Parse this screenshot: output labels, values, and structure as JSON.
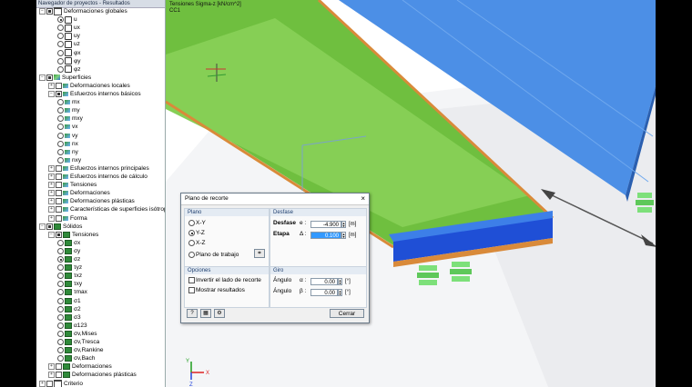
{
  "navigator": {
    "title": "Navegador de proyectos - Resultados",
    "rows": [
      {
        "label": "Deformaciones globales",
        "indent": 0,
        "toggle": "−",
        "kind": "cb",
        "checked": true,
        "icon": "ico-def"
      },
      {
        "label": "u",
        "indent": 2,
        "kind": "rd",
        "checked": true,
        "icon": "ico-mode"
      },
      {
        "label": "ux",
        "indent": 2,
        "kind": "rd",
        "icon": "ico-mode"
      },
      {
        "label": "uy",
        "indent": 2,
        "kind": "rd",
        "icon": "ico-mode"
      },
      {
        "label": "uz",
        "indent": 2,
        "kind": "rd",
        "icon": "ico-mode"
      },
      {
        "label": "φx",
        "indent": 2,
        "kind": "rd",
        "icon": "ico-mode"
      },
      {
        "label": "φy",
        "indent": 2,
        "kind": "rd",
        "icon": "ico-mode"
      },
      {
        "label": "φz",
        "indent": 2,
        "kind": "rd",
        "icon": "ico-mode"
      },
      {
        "label": "Superficies",
        "indent": 0,
        "toggle": "−",
        "kind": "cb",
        "checked": true,
        "icon": "ico-surf"
      },
      {
        "label": "Deformaciones locales",
        "indent": 1,
        "toggle": "+",
        "kind": "cb",
        "icon": "ico-sub"
      },
      {
        "label": "Esfuerzos internos básicos",
        "indent": 1,
        "toggle": "−",
        "kind": "cb",
        "checked": true,
        "icon": "ico-sub"
      },
      {
        "label": "mx",
        "indent": 2,
        "kind": "rd",
        "icon": "ico-sub"
      },
      {
        "label": "my",
        "indent": 2,
        "kind": "rd",
        "icon": "ico-sub"
      },
      {
        "label": "mxy",
        "indent": 2,
        "kind": "rd",
        "icon": "ico-sub"
      },
      {
        "label": "vx",
        "indent": 2,
        "kind": "rd",
        "icon": "ico-sub"
      },
      {
        "label": "vy",
        "indent": 2,
        "kind": "rd",
        "icon": "ico-sub"
      },
      {
        "label": "nx",
        "indent": 2,
        "kind": "rd",
        "icon": "ico-sub"
      },
      {
        "label": "ny",
        "indent": 2,
        "kind": "rd",
        "icon": "ico-sub"
      },
      {
        "label": "nxy",
        "indent": 2,
        "kind": "rd",
        "icon": "ico-sub"
      },
      {
        "label": "Esfuerzos internos principales",
        "indent": 1,
        "toggle": "+",
        "kind": "cb",
        "icon": "ico-sub"
      },
      {
        "label": "Esfuerzos internos de cálculo",
        "indent": 1,
        "toggle": "+",
        "kind": "cb",
        "icon": "ico-sub"
      },
      {
        "label": "Tensiones",
        "indent": 1,
        "toggle": "+",
        "kind": "cb",
        "icon": "ico-sub"
      },
      {
        "label": "Deformaciones",
        "indent": 1,
        "toggle": "+",
        "kind": "cb",
        "icon": "ico-sub"
      },
      {
        "label": "Deformaciones plásticas",
        "indent": 1,
        "toggle": "+",
        "kind": "cb",
        "icon": "ico-sub"
      },
      {
        "label": "Características de superficies isótropas",
        "indent": 1,
        "toggle": "+",
        "kind": "cb",
        "icon": "ico-sub"
      },
      {
        "label": "Forma",
        "indent": 1,
        "toggle": "+",
        "kind": "cb",
        "icon": "ico-sub"
      },
      {
        "label": "Sólidos",
        "indent": 0,
        "toggle": "−",
        "kind": "cb",
        "checked": true,
        "icon": "ico-sol"
      },
      {
        "label": "Tensiones",
        "indent": 1,
        "toggle": "−",
        "kind": "cb",
        "checked": true,
        "icon": "ico-sol"
      },
      {
        "label": "σx",
        "indent": 2,
        "kind": "rd",
        "icon": "ico-sol"
      },
      {
        "label": "σy",
        "indent": 2,
        "kind": "rd",
        "icon": "ico-sol"
      },
      {
        "label": "σz",
        "indent": 2,
        "kind": "rd",
        "checked": true,
        "icon": "ico-sol"
      },
      {
        "label": "τyz",
        "indent": 2,
        "kind": "rd",
        "icon": "ico-sol"
      },
      {
        "label": "τxz",
        "indent": 2,
        "kind": "rd",
        "icon": "ico-sol"
      },
      {
        "label": "τxy",
        "indent": 2,
        "kind": "rd",
        "icon": "ico-sol"
      },
      {
        "label": "τmax",
        "indent": 2,
        "kind": "rd",
        "icon": "ico-sol"
      },
      {
        "label": "σ1",
        "indent": 2,
        "kind": "rd",
        "icon": "ico-sol"
      },
      {
        "label": "σ2",
        "indent": 2,
        "kind": "rd",
        "icon": "ico-sol"
      },
      {
        "label": "σ3",
        "indent": 2,
        "kind": "rd",
        "icon": "ico-sol"
      },
      {
        "label": "α123",
        "indent": 2,
        "kind": "rd",
        "icon": "ico-sol"
      },
      {
        "label": "σv,Mises",
        "indent": 2,
        "kind": "rd",
        "icon": "ico-sol"
      },
      {
        "label": "σv,Tresca",
        "indent": 2,
        "kind": "rd",
        "icon": "ico-sol"
      },
      {
        "label": "σv,Rankine",
        "indent": 2,
        "kind": "rd",
        "icon": "ico-sol"
      },
      {
        "label": "σv,Bach",
        "indent": 2,
        "kind": "rd",
        "icon": "ico-sol"
      },
      {
        "label": "Deformaciones",
        "indent": 1,
        "toggle": "+",
        "kind": "cb",
        "icon": "ico-sol"
      },
      {
        "label": "Deformaciones plásticas",
        "indent": 1,
        "toggle": "+",
        "kind": "cb",
        "icon": "ico-sol"
      },
      {
        "label": "Criterio",
        "indent": 0,
        "toggle": "+",
        "kind": "cb",
        "icon": "ico-def"
      }
    ]
  },
  "viewport": {
    "result_title": "Tensiones Sigma-z [kN/cm^2]",
    "load_case": "CC1",
    "axis_x": "X",
    "axis_y": "Y",
    "axis_z": "Z"
  },
  "dialog": {
    "title": "Plano de recorte",
    "close": "×",
    "plano": {
      "header": "Plano",
      "xy": "X-Y",
      "yz": "Y-Z",
      "xz": "X-Z",
      "workplane": "Plano de trabajo",
      "selected": "yz"
    },
    "desfase": {
      "header": "Desfase",
      "offset_label": "Desfase",
      "offset_symbol": "e :",
      "offset_value": "-4.900",
      "step_label": "Etapa",
      "step_symbol": "Δ :",
      "step_value": "0.100",
      "unit": "[m]"
    },
    "opciones": {
      "header": "Opciones",
      "invert": "Invertir el lado de recorte",
      "show_results": "Mostrar resultados"
    },
    "giro": {
      "header": "Giro",
      "angle_label": "Ángulo",
      "alpha_symbol": "α :",
      "alpha_value": "0.00",
      "beta_symbol": "β :",
      "beta_value": "0.00",
      "unit": "[°]"
    },
    "close_button": "Cerrar"
  },
  "colors": {
    "slab_green": "#5fb83a",
    "slab_blue": "#3f7fd8",
    "edge_orange": "#d98a3a",
    "support_green": "#7de07a"
  }
}
